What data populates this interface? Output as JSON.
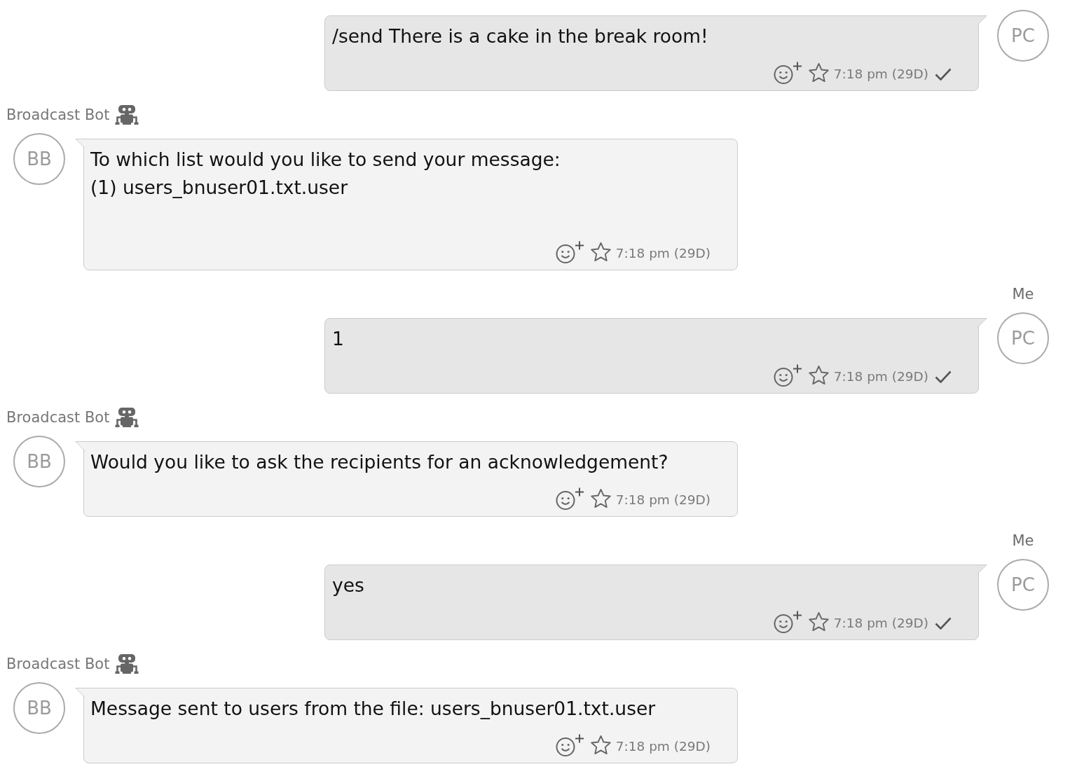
{
  "messages": [
    {
      "kind": "outgoing",
      "avatar": "PC",
      "text": "/send There is a cake in the break room!",
      "starred": false,
      "time": "7:18 pm (29D)",
      "delivered": true
    },
    {
      "kind": "incoming",
      "sender": "Broadcast Bot",
      "bot": true,
      "avatar": "BB",
      "text": "To which list would you like to send your message:\n(1) users_bnuser01.txt.user\n\n",
      "starred": false,
      "time": "7:18 pm (29D)"
    },
    {
      "kind": "outgoing",
      "sender": "Me",
      "avatar": "PC",
      "text": "1",
      "starred": false,
      "time": "7:18 pm (29D)",
      "delivered": true
    },
    {
      "kind": "incoming",
      "sender": "Broadcast Bot",
      "bot": true,
      "avatar": "BB",
      "text": "Would you like to ask the recipients for an acknowledgement?",
      "starred": false,
      "time": "7:18 pm (29D)"
    },
    {
      "kind": "outgoing",
      "sender": "Me",
      "avatar": "PC",
      "text": "yes",
      "starred": false,
      "time": "7:18 pm (29D)",
      "delivered": true
    },
    {
      "kind": "incoming",
      "sender": "Broadcast Bot",
      "bot": true,
      "avatar": "BB",
      "text": "Message sent to users from the file: users_bnuser01.txt.user",
      "starred": false,
      "time": "7:18 pm (29D)"
    }
  ]
}
